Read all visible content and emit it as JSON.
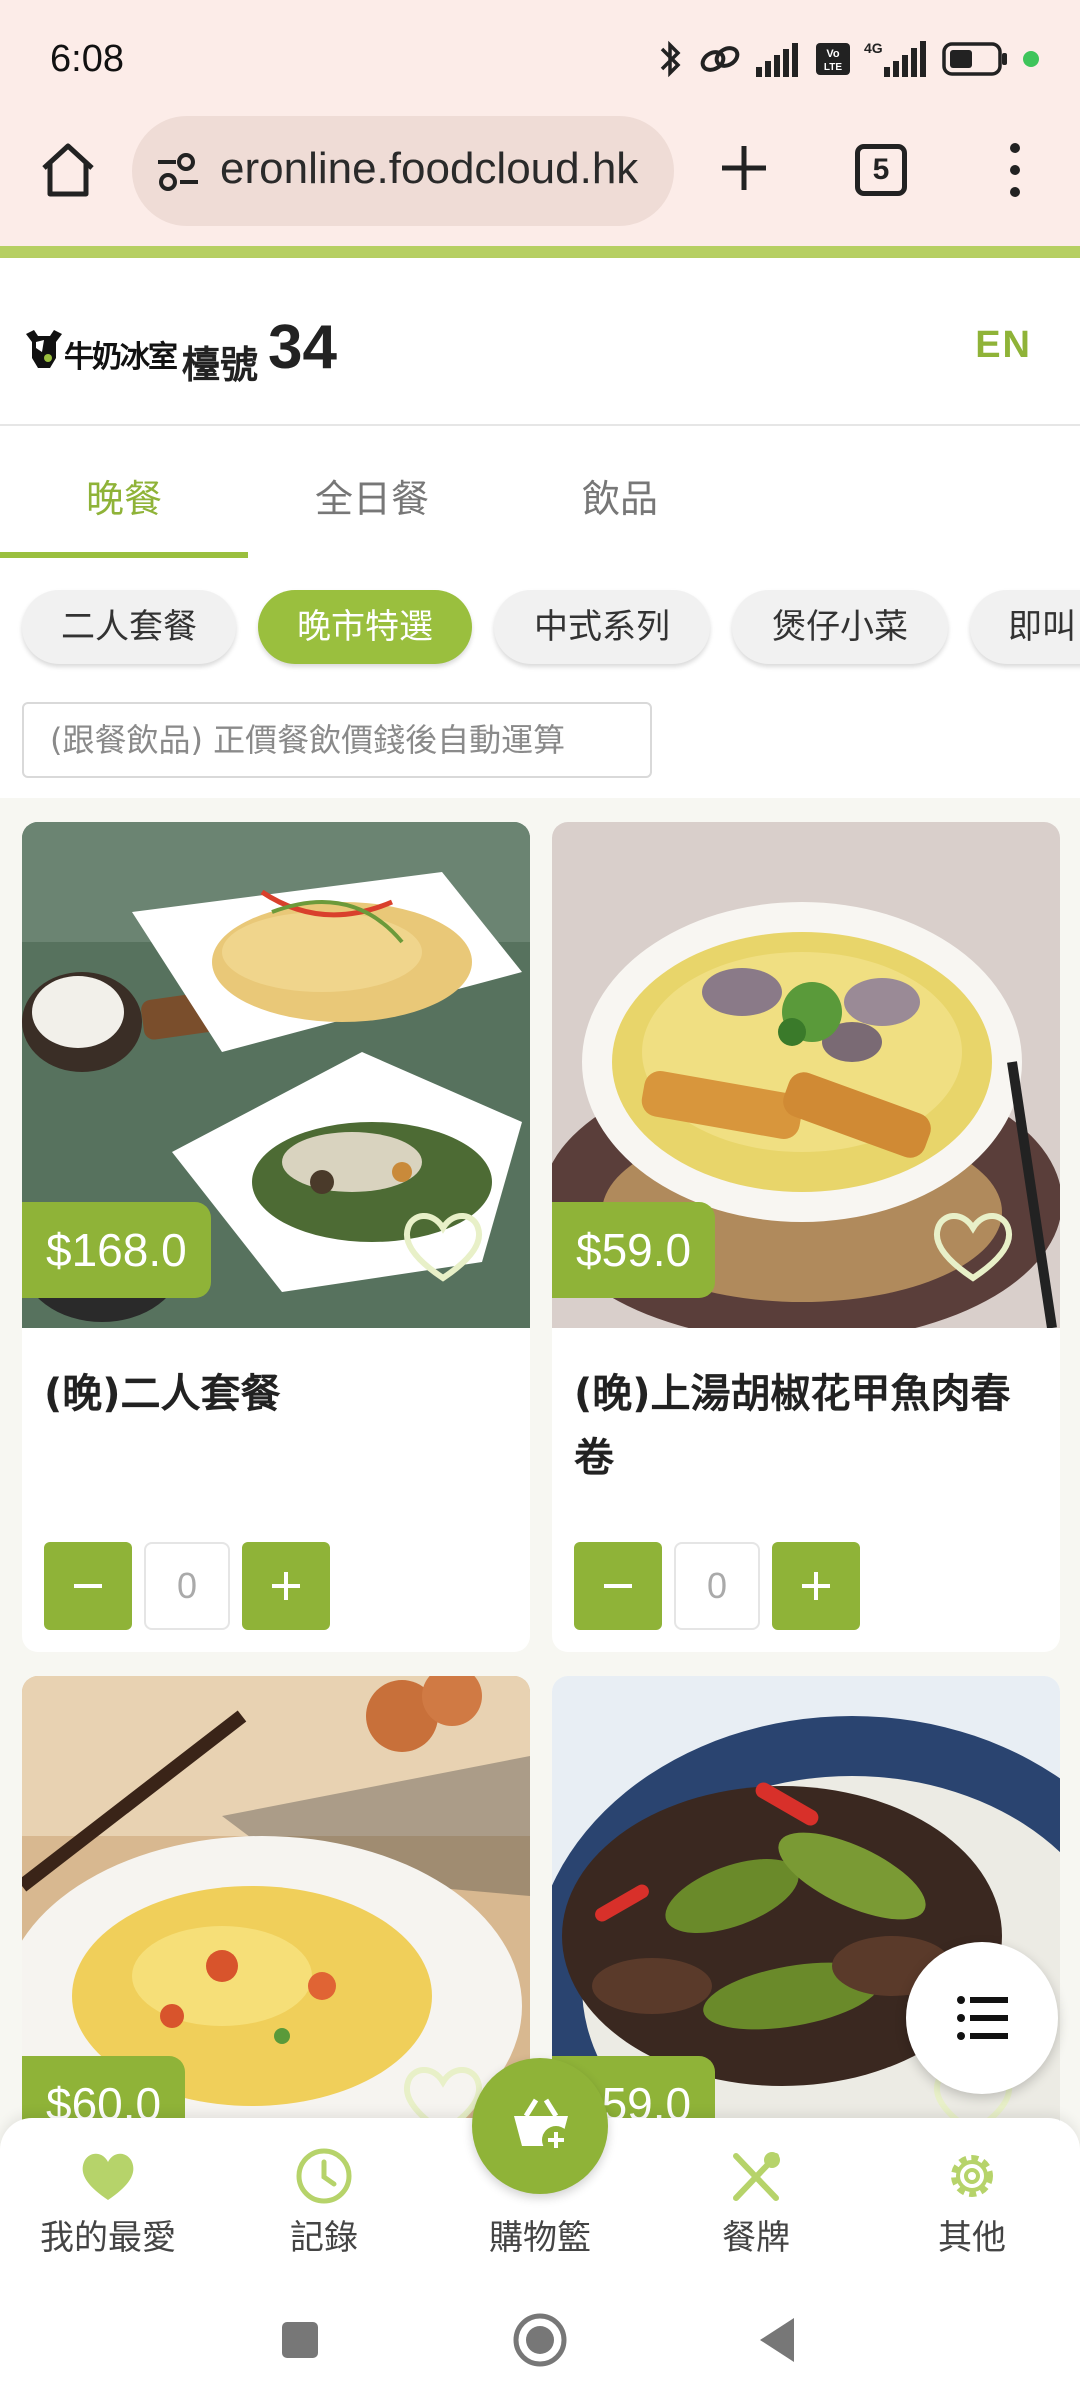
{
  "status_bar": {
    "time": "6:08",
    "icons": [
      "bluetooth-icon",
      "link-icon",
      "signal-icon",
      "volte-icon",
      "4g-signal-icon",
      "battery-icon",
      "active-dot-icon"
    ],
    "network_label": "4G",
    "volte_label": "Vo LTE"
  },
  "browser": {
    "url": "eronline.foodcloud.hk",
    "tab_count": "5",
    "accent_color": "#b6cf62"
  },
  "header": {
    "logo_text": "牛奶冰室",
    "table_label": "檯號",
    "table_number": "34",
    "language_toggle": "EN"
  },
  "main_tabs": [
    {
      "label": "晚餐",
      "active": true
    },
    {
      "label": "全日餐",
      "active": false
    },
    {
      "label": "飲品",
      "active": false
    }
  ],
  "category_chips": [
    {
      "label": "二人套餐",
      "active": false
    },
    {
      "label": "晚市特選",
      "active": true
    },
    {
      "label": "中式系列",
      "active": false
    },
    {
      "label": "煲仔小菜",
      "active": false
    },
    {
      "label": "即叫",
      "active": false
    }
  ],
  "notice": "(跟餐飲品) 正價餐飲價錢後自動運算",
  "products": [
    {
      "name": "(晚)二人套餐",
      "price": "$168.0",
      "quantity": "0",
      "favorited": false
    },
    {
      "name": "(晚)上湯胡椒花甲魚肉春卷",
      "price": "$59.0",
      "quantity": "0",
      "favorited": false
    },
    {
      "name": "",
      "price": "$60.0",
      "quantity": "0",
      "favorited": false
    },
    {
      "name": "",
      "price": "$59.0",
      "quantity": "0",
      "favorited": false
    }
  ],
  "bottom_nav": {
    "items": [
      {
        "label": "我的最愛",
        "icon": "heart-icon"
      },
      {
        "label": "記錄",
        "icon": "clock-icon"
      },
      {
        "label": "購物籃",
        "icon": "basket-icon"
      },
      {
        "label": "餐牌",
        "icon": "utensils-icon"
      },
      {
        "label": "其他",
        "icon": "gear-icon"
      }
    ]
  },
  "colors": {
    "brand_green": "#8fb338",
    "chip_active": "#9abf3e",
    "browser_bg": "#fcece8"
  }
}
